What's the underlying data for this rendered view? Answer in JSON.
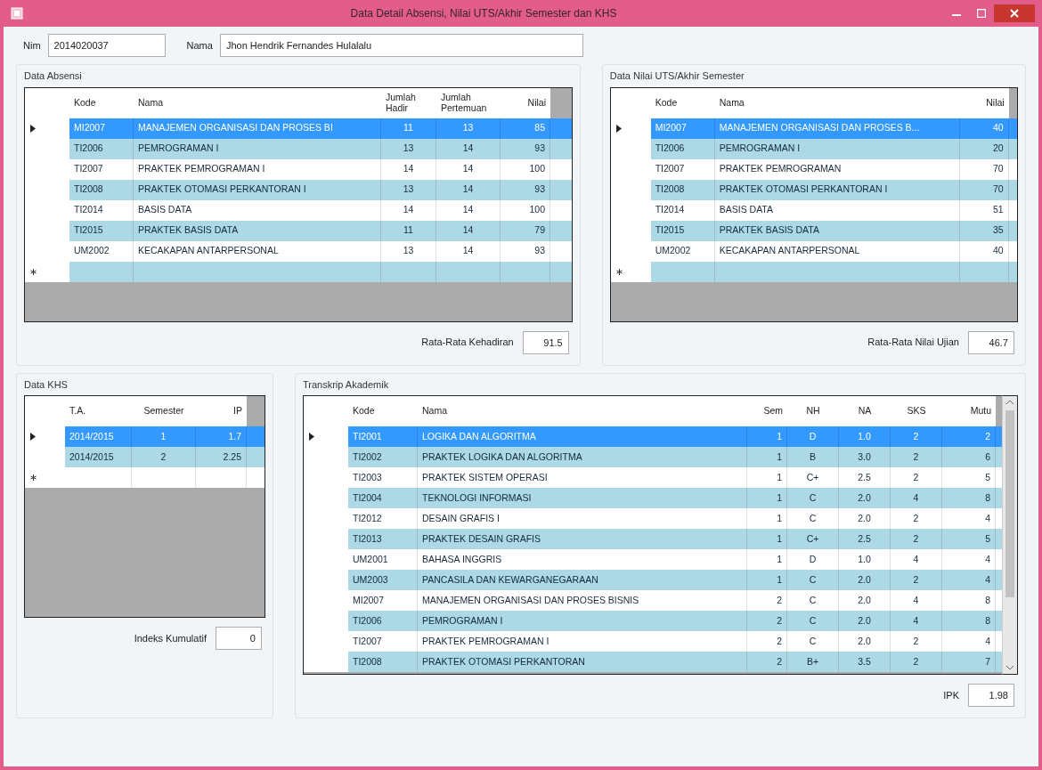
{
  "window": {
    "title": "Data Detail Absensi, Nilai UTS/Akhir Semester dan KHS"
  },
  "student": {
    "nim_label": "Nim",
    "nim": "2014020037",
    "name_label": "Nama",
    "name": "Jhon Hendrik Fernandes Hulalalu"
  },
  "attendance": {
    "title": "Data Absensi",
    "columns": [
      "Kode",
      "Nama",
      "Jumlah Hadir",
      "Jumlah Pertemuan",
      "Nilai"
    ],
    "new_row": true,
    "rows": [
      {
        "cells": [
          "MI2007",
          "MANAJEMEN ORGANISASI DAN PROSES BI",
          "11",
          "13",
          "85"
        ],
        "selected": true
      },
      {
        "cells": [
          "TI2006",
          "PEMROGRAMAN I",
          "13",
          "14",
          "93"
        ],
        "selected": false
      },
      {
        "cells": [
          "TI2007",
          "PRAKTEK PEMROGRAMAN I",
          "14",
          "14",
          "100"
        ],
        "selected": false
      },
      {
        "cells": [
          "TI2008",
          "PRAKTEK OTOMASI PERKANTORAN I",
          "13",
          "14",
          "93"
        ],
        "selected": false
      },
      {
        "cells": [
          "TI2014",
          "BASIS DATA",
          "14",
          "14",
          "100"
        ],
        "selected": false
      },
      {
        "cells": [
          "TI2015",
          "PRAKTEK BASIS DATA",
          "11",
          "14",
          "79"
        ],
        "selected": false
      },
      {
        "cells": [
          "UM2002",
          "KECAKAPAN ANTARPERSONAL",
          "13",
          "14",
          "93"
        ],
        "selected": false
      }
    ],
    "average_label": "Rata-Rata Kehadiran",
    "average": "91.5"
  },
  "exam": {
    "title": "Data Nilai UTS/Akhir Semester",
    "columns": [
      "Kode",
      "Nama",
      "Nilai"
    ],
    "new_row": true,
    "rows": [
      {
        "cells": [
          "MI2007",
          "MANAJEMEN ORGANISASI DAN PROSES B...",
          "40"
        ],
        "selected": true
      },
      {
        "cells": [
          "TI2006",
          "PEMROGRAMAN I",
          "20"
        ],
        "selected": false
      },
      {
        "cells": [
          "TI2007",
          "PRAKTEK PEMROGRAMAN",
          "70"
        ],
        "selected": false
      },
      {
        "cells": [
          "TI2008",
          "PRAKTEK OTOMASI PERKANTORAN I",
          "70"
        ],
        "selected": false
      },
      {
        "cells": [
          "TI2014",
          "BASIS DATA",
          "51"
        ],
        "selected": false
      },
      {
        "cells": [
          "TI2015",
          "PRAKTEK BASIS DATA",
          "35"
        ],
        "selected": false
      },
      {
        "cells": [
          "UM2002",
          "KECAKAPAN ANTARPERSONAL",
          "40"
        ],
        "selected": false
      }
    ],
    "average_label": "Rata-Rata Nilai Ujian",
    "average": "46.7"
  },
  "khs": {
    "title": "Data KHS",
    "columns": [
      "T.A.",
      "Semester",
      "IP"
    ],
    "new_row": true,
    "rows": [
      {
        "cells": [
          "2014/2015",
          "1",
          "1.7"
        ],
        "selected": true
      },
      {
        "cells": [
          "2014/2015",
          "2",
          "2.25"
        ],
        "selected": false
      }
    ],
    "average_label": "Indeks Kumulatif",
    "average": "0"
  },
  "transcript": {
    "title": "Transkrip Akademik",
    "columns": [
      "Kode",
      "Nama",
      "Sem",
      "NH",
      "NA",
      "SKS",
      "Mutu"
    ],
    "rows": [
      {
        "cells": [
          "TI2001",
          "LOGIKA DAN ALGORITMA",
          "1",
          "D",
          "1.0",
          "2",
          "2"
        ],
        "selected": true
      },
      {
        "cells": [
          "TI2002",
          "PRAKTEK LOGIKA DAN ALGORITMA",
          "1",
          "B",
          "3.0",
          "2",
          "6"
        ],
        "selected": false
      },
      {
        "cells": [
          "TI2003",
          "PRAKTEK SISTEM OPERASI",
          "1",
          "C+",
          "2.5",
          "2",
          "5"
        ],
        "selected": false
      },
      {
        "cells": [
          "TI2004",
          "TEKNOLOGI INFORMASI",
          "1",
          "C",
          "2.0",
          "4",
          "8"
        ],
        "selected": false
      },
      {
        "cells": [
          "TI2012",
          "DESAIN GRAFIS I",
          "1",
          "C",
          "2.0",
          "2",
          "4"
        ],
        "selected": false
      },
      {
        "cells": [
          "TI2013",
          "PRAKTEK DESAIN GRAFIS",
          "1",
          "C+",
          "2.5",
          "2",
          "5"
        ],
        "selected": false
      },
      {
        "cells": [
          "UM2001",
          "BAHASA INGGRIS",
          "1",
          "D",
          "1.0",
          "4",
          "4"
        ],
        "selected": false
      },
      {
        "cells": [
          "UM2003",
          "PANCASILA DAN KEWARGANEGARAAN",
          "1",
          "C",
          "2.0",
          "2",
          "4"
        ],
        "selected": false
      },
      {
        "cells": [
          "MI2007",
          "MANAJEMEN ORGANISASI DAN PROSES BISNIS",
          "2",
          "C",
          "2.0",
          "4",
          "8"
        ],
        "selected": false
      },
      {
        "cells": [
          "TI2006",
          "PEMROGRAMAN I",
          "2",
          "C",
          "2.0",
          "4",
          "8"
        ],
        "selected": false
      },
      {
        "cells": [
          "TI2007",
          "PRAKTEK PEMROGRAMAN I",
          "2",
          "C",
          "2.0",
          "2",
          "4"
        ],
        "selected": false
      },
      {
        "cells": [
          "TI2008",
          "PRAKTEK OTOMASI PERKANTORAN",
          "2",
          "B+",
          "3.5",
          "2",
          "7"
        ],
        "selected": false
      }
    ],
    "average_label": "IPK",
    "average": "1.98"
  }
}
